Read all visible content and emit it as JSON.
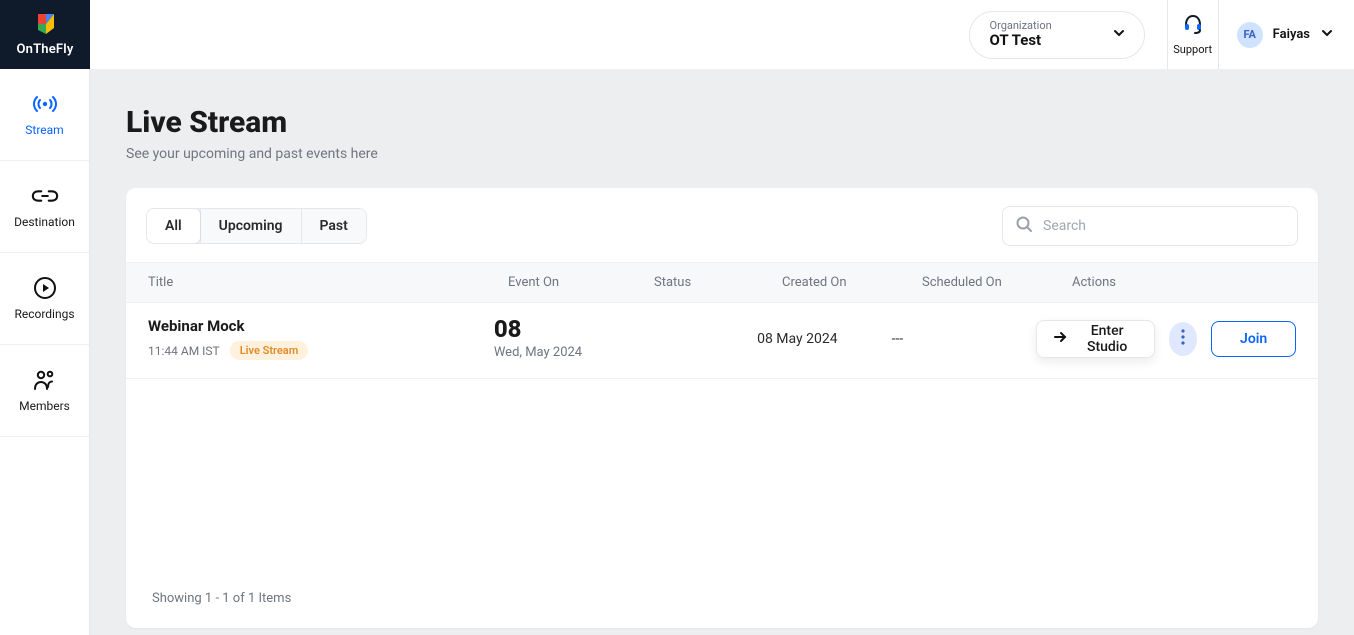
{
  "brand": {
    "name": "OnTheFly"
  },
  "sidebar": {
    "items": [
      {
        "label": "Stream"
      },
      {
        "label": "Destination"
      },
      {
        "label": "Recordings"
      },
      {
        "label": "Members"
      }
    ]
  },
  "topbar": {
    "org_label": "Organization",
    "org_name": "OT Test",
    "support_label": "Support",
    "user_initials": "FA",
    "user_name": "Faiyas"
  },
  "page": {
    "title": "Live Stream",
    "subtitle": "See your upcoming and past events here"
  },
  "tabs": [
    {
      "label": "All"
    },
    {
      "label": "Upcoming"
    },
    {
      "label": "Past"
    }
  ],
  "search": {
    "placeholder": "Search"
  },
  "columns": {
    "title": "Title",
    "event_on": "Event On",
    "status": "Status",
    "created_on": "Created On",
    "scheduled_on": "Scheduled On",
    "actions": "Actions"
  },
  "rows": [
    {
      "title": "Webinar Mock",
      "time": "11:44 AM IST",
      "badge": "Live Stream",
      "event_day": "08",
      "event_date": "Wed, May 2024",
      "status": "",
      "created_on": "08 May 2024",
      "scheduled_on": "---",
      "enter_studio": "Enter Studio",
      "join": "Join"
    }
  ],
  "footer": "Showing 1 - 1 of 1 Items"
}
